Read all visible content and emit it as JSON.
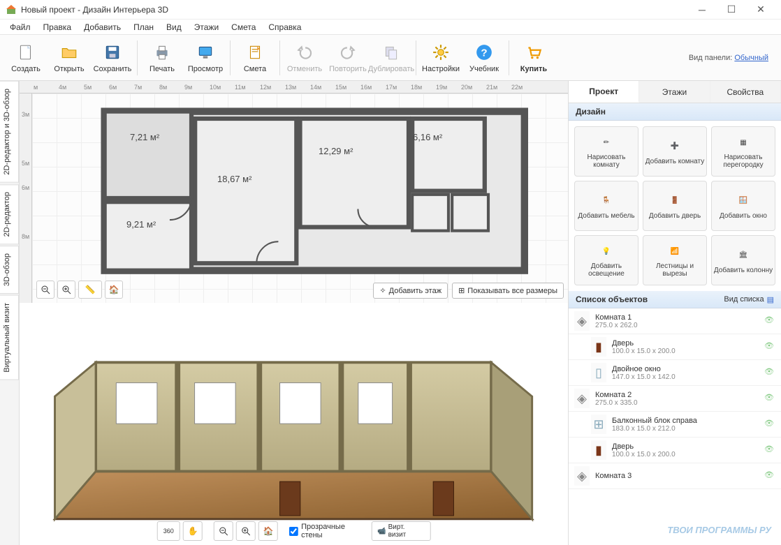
{
  "window": {
    "title": "Новый проект - Дизайн Интерьера 3D"
  },
  "menu": [
    "Файл",
    "Правка",
    "Добавить",
    "План",
    "Вид",
    "Этажи",
    "Смета",
    "Справка"
  ],
  "toolbar": {
    "create": "Создать",
    "open": "Открыть",
    "save": "Сохранить",
    "print": "Печать",
    "preview": "Просмотр",
    "estimate": "Смета",
    "undo": "Отменить",
    "redo": "Повторить",
    "duplicate": "Дублировать",
    "settings": "Настройки",
    "tutorial": "Учебник",
    "buy": "Купить",
    "panel_label": "Вид панели:",
    "panel_mode": "Обычный"
  },
  "vtabs": {
    "combo": "2D-редактор и 3D-обзор",
    "editor2d": "2D-редактор",
    "view3d": "3D-обзор",
    "virtual": "Виртуальный визит"
  },
  "ruler_h": [
    "м",
    "4м",
    "5м",
    "6м",
    "7м",
    "8м",
    "9м",
    "10м",
    "11м",
    "12м",
    "13м",
    "14м",
    "15м",
    "16м",
    "17м",
    "18м",
    "19м",
    "20м",
    "21м",
    "22м"
  ],
  "ruler_v": [
    "3м",
    "5м",
    "6м",
    "8м"
  ],
  "rooms": {
    "r1": "7,21 м²",
    "r2": "18,67 м²",
    "r3": "9,21 м²",
    "r4": "12,29 м²",
    "r5": "6,16 м²"
  },
  "plan_actions": {
    "add_floor": "Добавить этаж",
    "show_dims": "Показывать все размеры"
  },
  "view3d_controls": {
    "rotate360": "360",
    "transparent": "Прозрачные стены",
    "video": "Вирт. визит"
  },
  "rtabs": {
    "project": "Проект",
    "floors": "Этажи",
    "props": "Свойства"
  },
  "sections": {
    "design": "Дизайн",
    "objects": "Список объектов",
    "view_list": "Вид списка"
  },
  "design_buttons": [
    {
      "label": "Нарисовать комнату",
      "icon": "✏"
    },
    {
      "label": "Добавить комнату",
      "icon": "➕"
    },
    {
      "label": "Нарисовать перегородку",
      "icon": "▦"
    },
    {
      "label": "Добавить мебель",
      "icon": "🪑"
    },
    {
      "label": "Добавить дверь",
      "icon": "🚪"
    },
    {
      "label": "Добавить окно",
      "icon": "🪟"
    },
    {
      "label": "Добавить освещение",
      "icon": "💡"
    },
    {
      "label": "Лестницы и вырезы",
      "icon": "📶"
    },
    {
      "label": "Добавить колонну",
      "icon": "🏛"
    }
  ],
  "objects": [
    {
      "name": "Комната 1",
      "dim": "275.0 x 262.0",
      "type": "room",
      "indent": false
    },
    {
      "name": "Дверь",
      "dim": "100.0 x 15.0 x 200.0",
      "type": "door",
      "indent": true
    },
    {
      "name": "Двойное окно",
      "dim": "147.0 x 15.0 x 142.0",
      "type": "window",
      "indent": true
    },
    {
      "name": "Комната 2",
      "dim": "275.0 x 335.0",
      "type": "room",
      "indent": false
    },
    {
      "name": "Балконный блок справа",
      "dim": "183.0 x 15.0 x 212.0",
      "type": "balcony",
      "indent": true
    },
    {
      "name": "Дверь",
      "dim": "100.0 x 15.0 x 200.0",
      "type": "door",
      "indent": true
    },
    {
      "name": "Комната 3",
      "dim": "",
      "type": "room",
      "indent": false
    }
  ],
  "watermark": "ТВОИ ПРОГРАММЫ РУ"
}
